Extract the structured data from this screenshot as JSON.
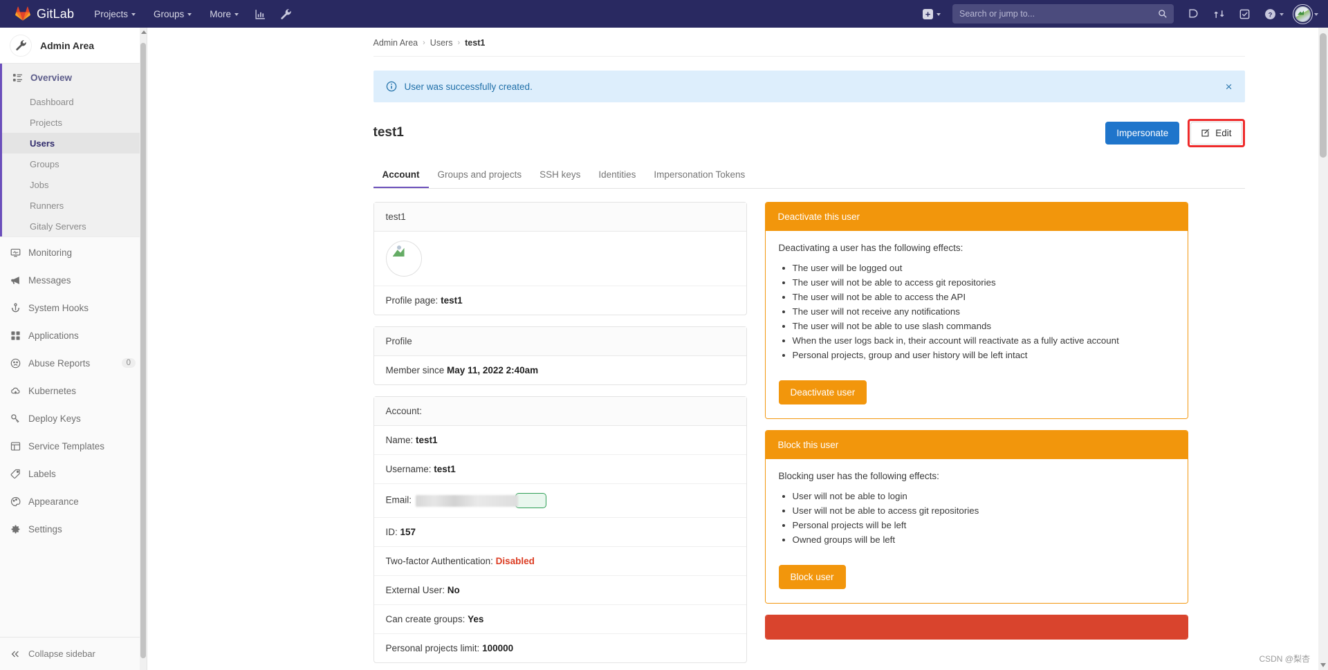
{
  "navbar": {
    "brand": "GitLab",
    "items": [
      {
        "label": "Projects",
        "caret": true
      },
      {
        "label": "Groups",
        "caret": true
      },
      {
        "label": "More",
        "caret": true
      }
    ],
    "icon_buttons": [
      {
        "name": "analytics-icon"
      },
      {
        "name": "wrench-icon"
      }
    ],
    "create_new": {
      "label": "+",
      "caret": true
    },
    "search": {
      "placeholder": "Search or jump to...",
      "value": ""
    },
    "right_icons": [
      {
        "name": "issues-icon"
      },
      {
        "name": "merge-requests-icon"
      },
      {
        "name": "todos-icon"
      },
      {
        "name": "help-icon",
        "caret": true
      }
    ],
    "avatar": {
      "caret": true
    }
  },
  "sidebar": {
    "header": "Admin Area",
    "overview": {
      "label": "Overview",
      "children": [
        {
          "label": "Dashboard",
          "active": false
        },
        {
          "label": "Projects",
          "active": false
        },
        {
          "label": "Users",
          "active": true
        },
        {
          "label": "Groups",
          "active": false
        },
        {
          "label": "Jobs",
          "active": false
        },
        {
          "label": "Runners",
          "active": false
        },
        {
          "label": "Gitaly Servers",
          "active": false
        }
      ]
    },
    "items": [
      {
        "label": "Monitoring",
        "icon": "monitor-icon",
        "badge": ""
      },
      {
        "label": "Messages",
        "icon": "megaphone-icon",
        "badge": ""
      },
      {
        "label": "System Hooks",
        "icon": "hook-icon",
        "badge": ""
      },
      {
        "label": "Applications",
        "icon": "apps-icon",
        "badge": ""
      },
      {
        "label": "Abuse Reports",
        "icon": "frown-icon",
        "badge": "0"
      },
      {
        "label": "Kubernetes",
        "icon": "cloud-icon",
        "badge": ""
      },
      {
        "label": "Deploy Keys",
        "icon": "key-icon",
        "badge": ""
      },
      {
        "label": "Service Templates",
        "icon": "template-icon",
        "badge": ""
      },
      {
        "label": "Labels",
        "icon": "label-icon",
        "badge": ""
      },
      {
        "label": "Appearance",
        "icon": "palette-icon",
        "badge": ""
      },
      {
        "label": "Settings",
        "icon": "gear-icon",
        "badge": ""
      }
    ],
    "collapse": "Collapse sidebar"
  },
  "breadcrumb": {
    "root": "Admin Area",
    "section": "Users",
    "current": "test1",
    "separator": "›"
  },
  "alert": {
    "message": "User was successfully created.",
    "close": "×",
    "color": "#ddeefc"
  },
  "header": {
    "title": "test1",
    "impersonate_label": "Impersonate",
    "edit_label": "Edit",
    "primary_color": "#1f75cb",
    "highlight_color": "#ee2a2a"
  },
  "tabs": [
    {
      "label": "Account",
      "active": true
    },
    {
      "label": "Groups and projects",
      "active": false
    },
    {
      "label": "SSH keys",
      "active": false
    },
    {
      "label": "Identities",
      "active": false
    },
    {
      "label": "Impersonation Tokens",
      "active": false
    }
  ],
  "user_card": {
    "title": "test1",
    "profile_page_label": "Profile page:",
    "profile_page_value": "test1"
  },
  "profile_card": {
    "title": "Profile",
    "member_since_label": "Member since",
    "member_since_value": "May 11, 2022 2:40am"
  },
  "account_card": {
    "title": "Account:",
    "rows": [
      {
        "label": "Name:",
        "value": "test1",
        "type": "text"
      },
      {
        "label": "Username:",
        "value": "test1",
        "type": "text"
      },
      {
        "label": "Email:",
        "value": "",
        "type": "redacted"
      },
      {
        "label": "ID:",
        "value": "157",
        "type": "text"
      },
      {
        "label": "Two-factor Authentication:",
        "value": "Disabled",
        "type": "danger"
      },
      {
        "label": "External User:",
        "value": "No",
        "type": "text"
      },
      {
        "label": "Can create groups:",
        "value": "Yes",
        "type": "text"
      },
      {
        "label": "Personal projects limit:",
        "value": "100000",
        "type": "text"
      }
    ]
  },
  "deactivate_panel": {
    "heading": "Deactivate this user",
    "lead": "Deactivating a user has the following effects:",
    "effects": [
      "The user will be logged out",
      "The user will not be able to access git repositories",
      "The user will not be able to access the API",
      "The user will not receive any notifications",
      "The user will not be able to use slash commands",
      "When the user logs back in, their account will reactivate as a fully active account",
      "Personal projects, group and user history will be left intact"
    ],
    "button": "Deactivate user",
    "color": "#f2960c"
  },
  "block_panel": {
    "heading": "Block this user",
    "lead": "Blocking user has the following effects:",
    "effects": [
      "User will not be able to login",
      "User will not be able to access git repositories",
      "Personal projects will be left",
      "Owned groups will be left"
    ],
    "button": "Block user",
    "color": "#f2960c"
  },
  "danger_panel": {
    "heading": "",
    "color": "#d9442d"
  },
  "watermark": "CSDN @梨杏"
}
